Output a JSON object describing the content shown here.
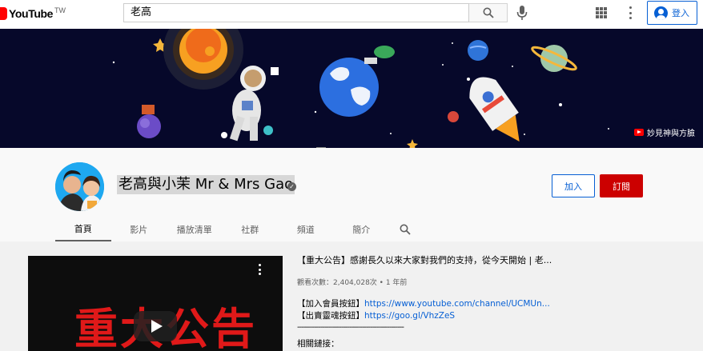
{
  "masthead": {
    "logo_text": "YouTube",
    "country_code": "TW",
    "search_value": "老高",
    "signin_label": "登入",
    "icons": [
      "youtube-logo-icon",
      "search-icon",
      "mic-icon",
      "apps-icon",
      "more-vert-icon",
      "account-circle-icon"
    ]
  },
  "banner": {
    "link_label": "妙見神與方臉"
  },
  "channel": {
    "name": "老高與小茉 Mr & Mrs Gao",
    "join_label": "加入",
    "subscribe_label": "訂閱",
    "tabs": [
      {
        "label": "首頁",
        "active": true
      },
      {
        "label": "影片",
        "active": false
      },
      {
        "label": "播放清單",
        "active": false
      },
      {
        "label": "社群",
        "active": false
      },
      {
        "label": "頻道",
        "active": false
      },
      {
        "label": "簡介",
        "active": false
      }
    ]
  },
  "featured": {
    "thumbnail_text": "重大公告",
    "title": "【重大公告】感謝長久以來大家對我們的支持，從今天開始 | 老...",
    "meta": "觀看次數：2,404,028次 • 1 年前",
    "line1_label": "【加入會員按鈕】",
    "line1_link": "https://www.youtube.com/channel/UCMUn...",
    "line2_label": "【出賣靈魂按鈕】",
    "line2_link": "https://goo.gl/VhzZeS",
    "divider": "---------------------------------------------------",
    "related": "相關鏈接："
  },
  "colors": {
    "brand_red": "#ff0000",
    "subscribe_red": "#cc0000",
    "link_blue": "#065fd4",
    "banner_bg": "#06082a"
  }
}
